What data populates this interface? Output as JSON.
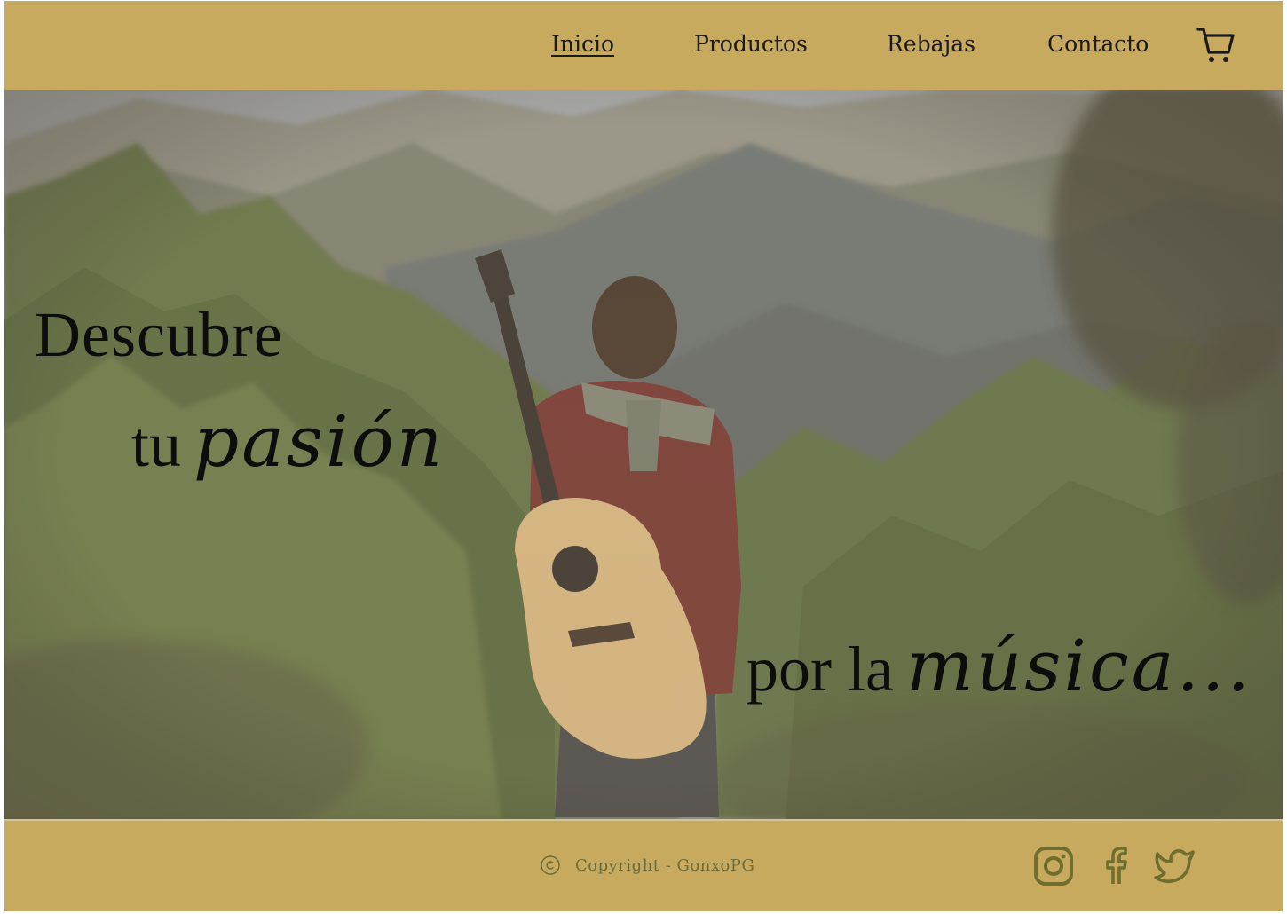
{
  "nav": {
    "items": [
      {
        "label": "Inicio",
        "active": true
      },
      {
        "label": "Productos",
        "active": false
      },
      {
        "label": "Rebajas",
        "active": false
      },
      {
        "label": "Contacto",
        "active": false
      }
    ],
    "cart_icon": "shopping-cart-icon"
  },
  "hero": {
    "line1": "Descubre",
    "line2_plain": "tu",
    "line2_script": "pasión",
    "line3_plain": "por la",
    "line3_script": "música..."
  },
  "footer": {
    "copyright_icon": "copyright-icon",
    "copyright_text": "Copyright - GonxoPG",
    "social": [
      "instagram-icon",
      "facebook-icon",
      "twitter-icon"
    ]
  },
  "colors": {
    "bar": "#c8aa5e",
    "footer_text": "#6c6b3a",
    "social_icons": "#6e6e2e"
  }
}
